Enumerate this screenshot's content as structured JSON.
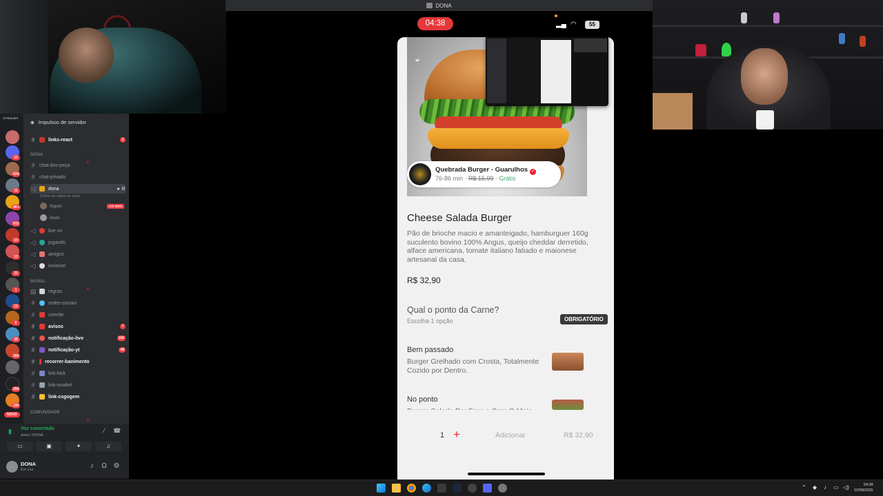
{
  "top_bar": {
    "title": "DONA"
  },
  "phone_status": {
    "time": "04:38",
    "battery": "55"
  },
  "discord": {
    "server_header": "Impulsos de servidor",
    "server_badges": [
      "12",
      "624",
      "11",
      "4K+",
      "612",
      "10",
      "13",
      "31",
      "1",
      "12",
      "6",
      "38",
      "366",
      "284",
      "190"
    ],
    "streamer_label": "STREAMER",
    "novo_label": "NOVO",
    "channels_top": [
      {
        "name": "links-react",
        "count": "1",
        "unread": true
      }
    ],
    "category_dona": "DONA",
    "channels_dona": [
      {
        "name": "chat-dos-peça"
      },
      {
        "name": "chat-privado"
      }
    ],
    "voice_active": {
      "name": "dona",
      "status_line": "Definir um status do canal"
    },
    "voice_users": [
      {
        "name": "foguin",
        "badge": "AO VIVO"
      },
      {
        "name": "dodo"
      }
    ],
    "voice_channels": [
      {
        "name": "live on"
      },
      {
        "name": "jogando"
      },
      {
        "name": "amigos"
      },
      {
        "name": "invisível"
      }
    ],
    "category_mural": "MURAL",
    "channels_mural": [
      {
        "name": "regras",
        "unread": false
      },
      {
        "name": "redes-sociais",
        "unread": false
      },
      {
        "name": "convite",
        "unread": false
      },
      {
        "name": "avisos",
        "unread": true,
        "count": "7"
      },
      {
        "name": "notificação-live",
        "unread": true,
        "count": "100"
      },
      {
        "name": "notificação-yt",
        "unread": true,
        "count": "48"
      },
      {
        "name": "recorrer-banimento",
        "unread": true
      },
      {
        "name": "link-kick",
        "unread": false
      },
      {
        "name": "link-onabet",
        "unread": false
      },
      {
        "name": "link-csgogem",
        "unread": true
      }
    ],
    "category_comunidade": "COMUNIDADE",
    "voice_connected": {
      "title": "Voz conectada",
      "subtitle": "dona / DONA"
    },
    "user": {
      "name": "DONA",
      "status": "Em voz"
    }
  },
  "app": {
    "store": {
      "name": "Quebrada Burger - Guarulhos",
      "eta": "76-86 min",
      "old_fee": "R$ 15,99",
      "fee": "Grátis"
    },
    "product": {
      "title": "Cheese Salada Burger",
      "description": "Pão de brioche macio e amanteigado, hamburguer 160g suculento bovino 100% Angus, queijo cheddar derretido, alface americana, tomate italiano fatiado e maionese artesanal da casa.",
      "price": "R$ 32,90"
    },
    "question": {
      "title": "Qual o ponto da Carne?",
      "subtitle": "Escolha 1 opção",
      "badge": "OBRIGATÓRIO"
    },
    "options": [
      {
        "name": "Bem passado",
        "description": "Burger Grelhado com Crosta, Totalmente Cozido por Dentro."
      },
      {
        "name": "No ponto",
        "description": "Burger Selado Por Fora e Com O Meio"
      }
    ],
    "cart": {
      "quantity": "1",
      "plus": "+",
      "add_label": "Adicionar",
      "total": "R$ 32,90"
    }
  },
  "taskbar": {
    "time": "04:38",
    "date": "10/08/2025"
  },
  "colors": {
    "brand_red": "#ea1d2c",
    "discord_bg": "#2b2d31",
    "discord_green": "#23a559"
  }
}
